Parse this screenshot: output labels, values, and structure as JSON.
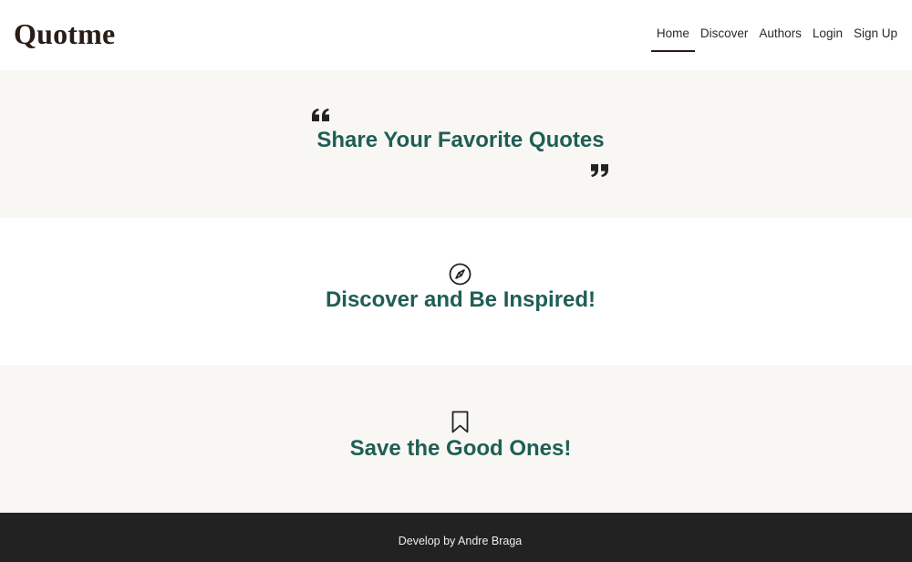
{
  "brand": {
    "name": "Quotme"
  },
  "nav": {
    "items": [
      {
        "label": "Home",
        "active": true
      },
      {
        "label": "Discover",
        "active": false
      },
      {
        "label": "Authors",
        "active": false
      },
      {
        "label": "Login",
        "active": false
      },
      {
        "label": "Sign Up",
        "active": false
      }
    ]
  },
  "sections": [
    {
      "icon": "quote-icon",
      "heading": "Share Your Favorite Quotes"
    },
    {
      "icon": "compass-icon",
      "heading": "Discover and Be Inspired!"
    },
    {
      "icon": "bookmark-icon",
      "heading": "Save the Good Ones!"
    }
  ],
  "footer": {
    "text": "Develop by Andre Braga"
  },
  "colors": {
    "accent": "#1f5e55",
    "brand_text": "#2a1c17",
    "beige_bg": "#f8f7f4",
    "footer_bg": "#222222"
  }
}
